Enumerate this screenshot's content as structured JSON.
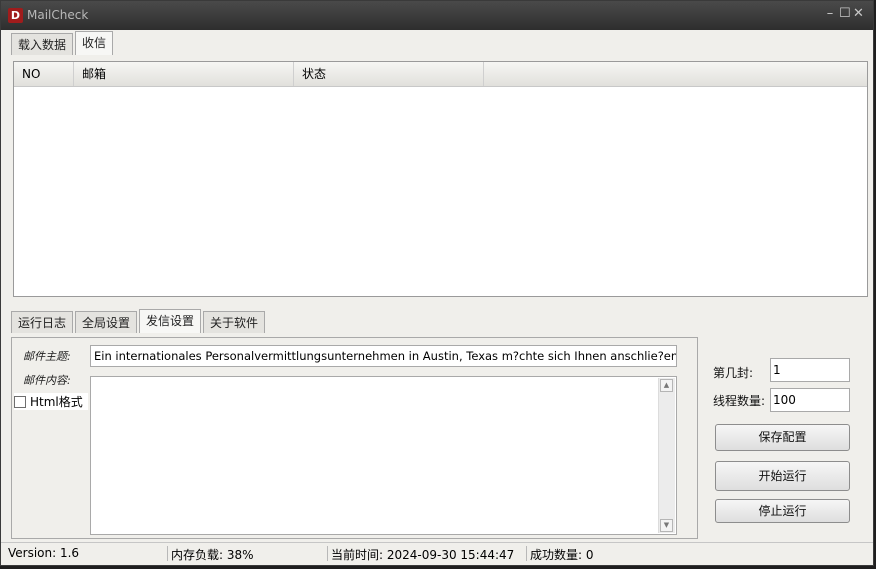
{
  "window": {
    "title": "MailCheck",
    "icon_letter": "D"
  },
  "top_tabs": [
    {
      "label": "载入数据"
    },
    {
      "label": "收信"
    }
  ],
  "table": {
    "columns": [
      "NO",
      "邮箱",
      "状态",
      ""
    ],
    "rows": []
  },
  "bottom_tabs": [
    {
      "label": "运行日志"
    },
    {
      "label": "全局设置"
    },
    {
      "label": "发信设置"
    },
    {
      "label": "关于软件"
    }
  ],
  "send_settings": {
    "subject_label": "邮件主题:",
    "subject_value": "Ein internationales Personalvermittlungsunternehmen in Austin, Texas m?chte sich Ihnen anschlie?en",
    "content_label": "邮件内容:",
    "content_value": "",
    "html_label": "Html格式",
    "html_checked": false
  },
  "side": {
    "nth_label": "第几封:",
    "nth_value": "1",
    "threads_label": "线程数量:",
    "threads_value": "100",
    "save_button": "保存配置",
    "start_button": "开始运行",
    "stop_button": "停止运行"
  },
  "status": {
    "version": "Version:  1.6",
    "memory": "内存负载:  38%",
    "time": "当前时间:  2024-09-30 15:44:47",
    "success": "成功数量:  0"
  },
  "colors": {
    "titlebar": "#3a3a3a",
    "panel": "#f0efeb",
    "app_icon": "#a01c1c"
  }
}
